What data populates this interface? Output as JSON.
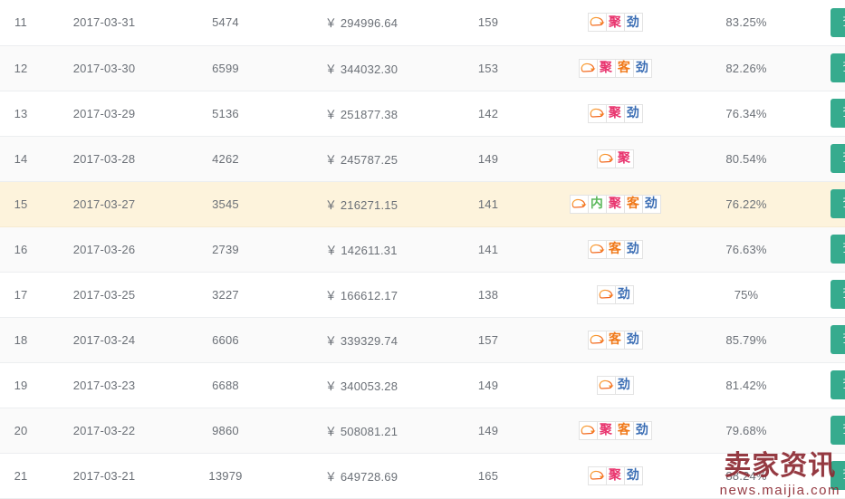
{
  "colors": {
    "button_bg": "#36ab8e",
    "row_highlight_bg": "#fdf3dc",
    "row_even_bg": "#fafafa",
    "row_odd_bg": "#ffffff",
    "border": "#eceef0",
    "text": "#6b7077",
    "tag_nei": "#5cb85c",
    "tag_ju": "#e8336d",
    "tag_ke": "#f07818",
    "tag_jin": "#3d6fb5",
    "ztc_icon": "#f2732a",
    "watermark": "#8d2a33"
  },
  "action": {
    "detail_label": "查看详情"
  },
  "tag_labels": {
    "ztc": "",
    "nei": "内",
    "ju": "聚",
    "ke": "客",
    "jin": "劲"
  },
  "watermark": {
    "brand": "卖家资讯",
    "url": "news.maijia.com"
  },
  "table": {
    "rows": [
      {
        "index": "11",
        "date": "2017-03-31",
        "visitors": "5474",
        "amount": "￥ 294996.64",
        "orders": "159",
        "tags": [
          "ztc",
          "ju",
          "jin"
        ],
        "rate": "83.25%",
        "highlight": false
      },
      {
        "index": "12",
        "date": "2017-03-30",
        "visitors": "6599",
        "amount": "￥ 344032.30",
        "orders": "153",
        "tags": [
          "ztc",
          "ju",
          "ke",
          "jin"
        ],
        "rate": "82.26%",
        "highlight": false
      },
      {
        "index": "13",
        "date": "2017-03-29",
        "visitors": "5136",
        "amount": "￥ 251877.38",
        "orders": "142",
        "tags": [
          "ztc",
          "ju",
          "jin"
        ],
        "rate": "76.34%",
        "highlight": false
      },
      {
        "index": "14",
        "date": "2017-03-28",
        "visitors": "4262",
        "amount": "￥ 245787.25",
        "orders": "149",
        "tags": [
          "ztc",
          "ju"
        ],
        "rate": "80.54%",
        "highlight": false
      },
      {
        "index": "15",
        "date": "2017-03-27",
        "visitors": "3545",
        "amount": "￥ 216271.15",
        "orders": "141",
        "tags": [
          "ztc",
          "nei",
          "ju",
          "ke",
          "jin"
        ],
        "rate": "76.22%",
        "highlight": true
      },
      {
        "index": "16",
        "date": "2017-03-26",
        "visitors": "2739",
        "amount": "￥ 142611.31",
        "orders": "141",
        "tags": [
          "ztc",
          "ke",
          "jin"
        ],
        "rate": "76.63%",
        "highlight": false
      },
      {
        "index": "17",
        "date": "2017-03-25",
        "visitors": "3227",
        "amount": "￥ 166612.17",
        "orders": "138",
        "tags": [
          "ztc",
          "jin"
        ],
        "rate": "75%",
        "highlight": false
      },
      {
        "index": "18",
        "date": "2017-03-24",
        "visitors": "6606",
        "amount": "￥ 339329.74",
        "orders": "157",
        "tags": [
          "ztc",
          "ke",
          "jin"
        ],
        "rate": "85.79%",
        "highlight": false
      },
      {
        "index": "19",
        "date": "2017-03-23",
        "visitors": "6688",
        "amount": "￥ 340053.28",
        "orders": "149",
        "tags": [
          "ztc",
          "jin"
        ],
        "rate": "81.42%",
        "highlight": false
      },
      {
        "index": "20",
        "date": "2017-03-22",
        "visitors": "9860",
        "amount": "￥ 508081.21",
        "orders": "149",
        "tags": [
          "ztc",
          "ju",
          "ke",
          "jin"
        ],
        "rate": "79.68%",
        "highlight": false
      },
      {
        "index": "21",
        "date": "2017-03-21",
        "visitors": "13979",
        "amount": "￥ 649728.69",
        "orders": "165",
        "tags": [
          "ztc",
          "ju",
          "jin"
        ],
        "rate": "88.24%",
        "highlight": false
      }
    ]
  }
}
